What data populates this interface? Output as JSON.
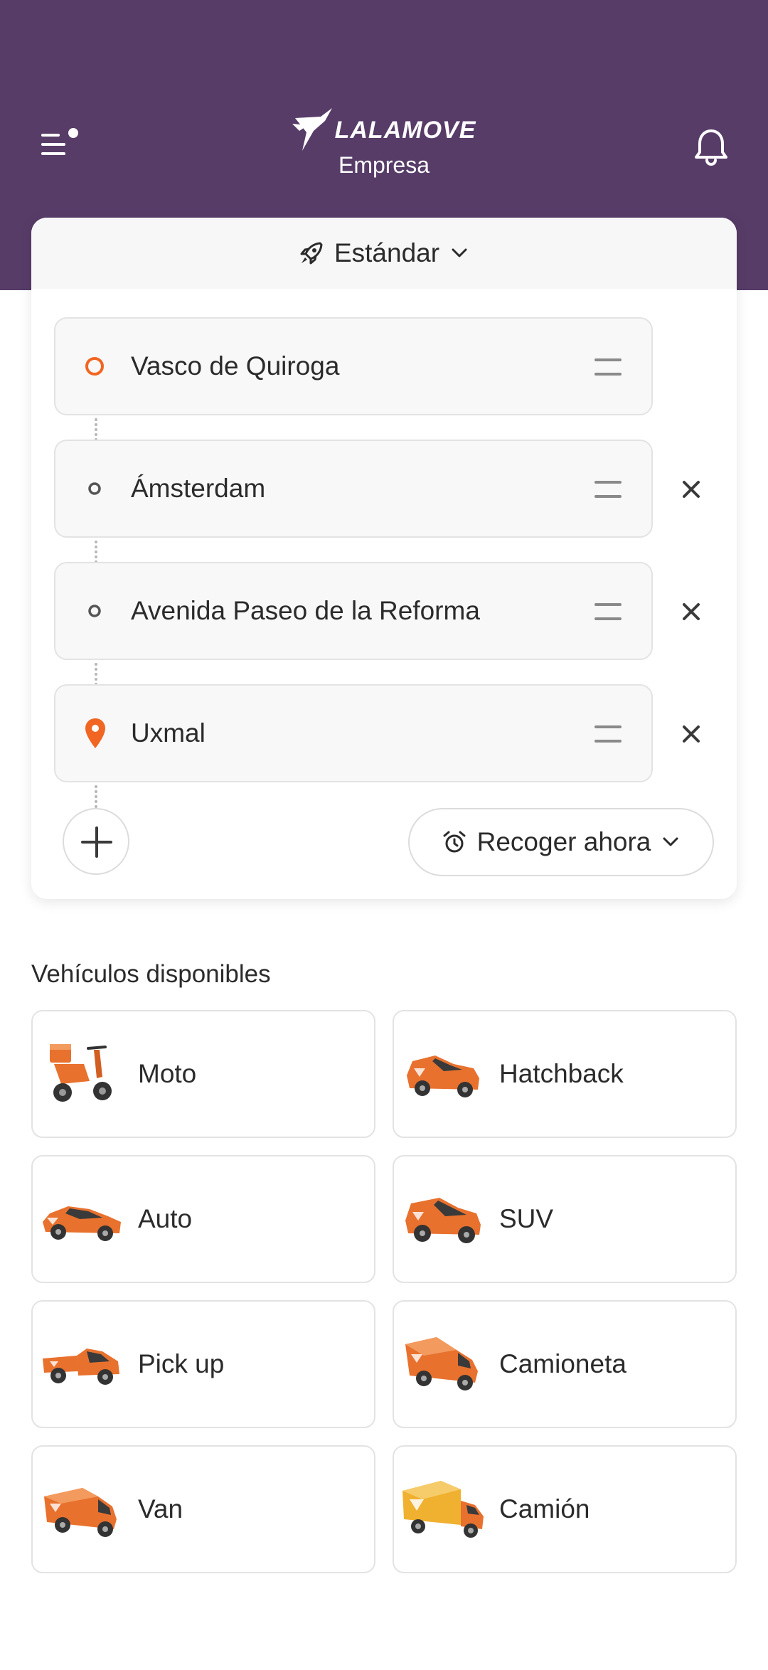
{
  "header": {
    "logo_text": "LALAMOVE",
    "subtitle": "Empresa",
    "colors": {
      "background": "#573c68",
      "accent": "#f16622"
    }
  },
  "service": {
    "label": "Estándar",
    "icon": "rocket-icon"
  },
  "stops": [
    {
      "label": "Vasco de Quiroga",
      "type": "pickup"
    },
    {
      "label": "Ámsterdam",
      "type": "waypoint"
    },
    {
      "label": "Avenida Paseo de la Reforma",
      "type": "waypoint"
    },
    {
      "label": "Uxmal",
      "type": "destination"
    }
  ],
  "pickup_time": {
    "label": "Recoger ahora",
    "icon": "alarm-clock-icon"
  },
  "vehicles_section": {
    "title": "Vehículos disponibles",
    "items": [
      {
        "name": "Moto"
      },
      {
        "name": "Hatchback"
      },
      {
        "name": "Auto"
      },
      {
        "name": "SUV"
      },
      {
        "name": "Pick up"
      },
      {
        "name": "Camioneta"
      },
      {
        "name": "Van"
      },
      {
        "name": "Camión"
      }
    ]
  }
}
